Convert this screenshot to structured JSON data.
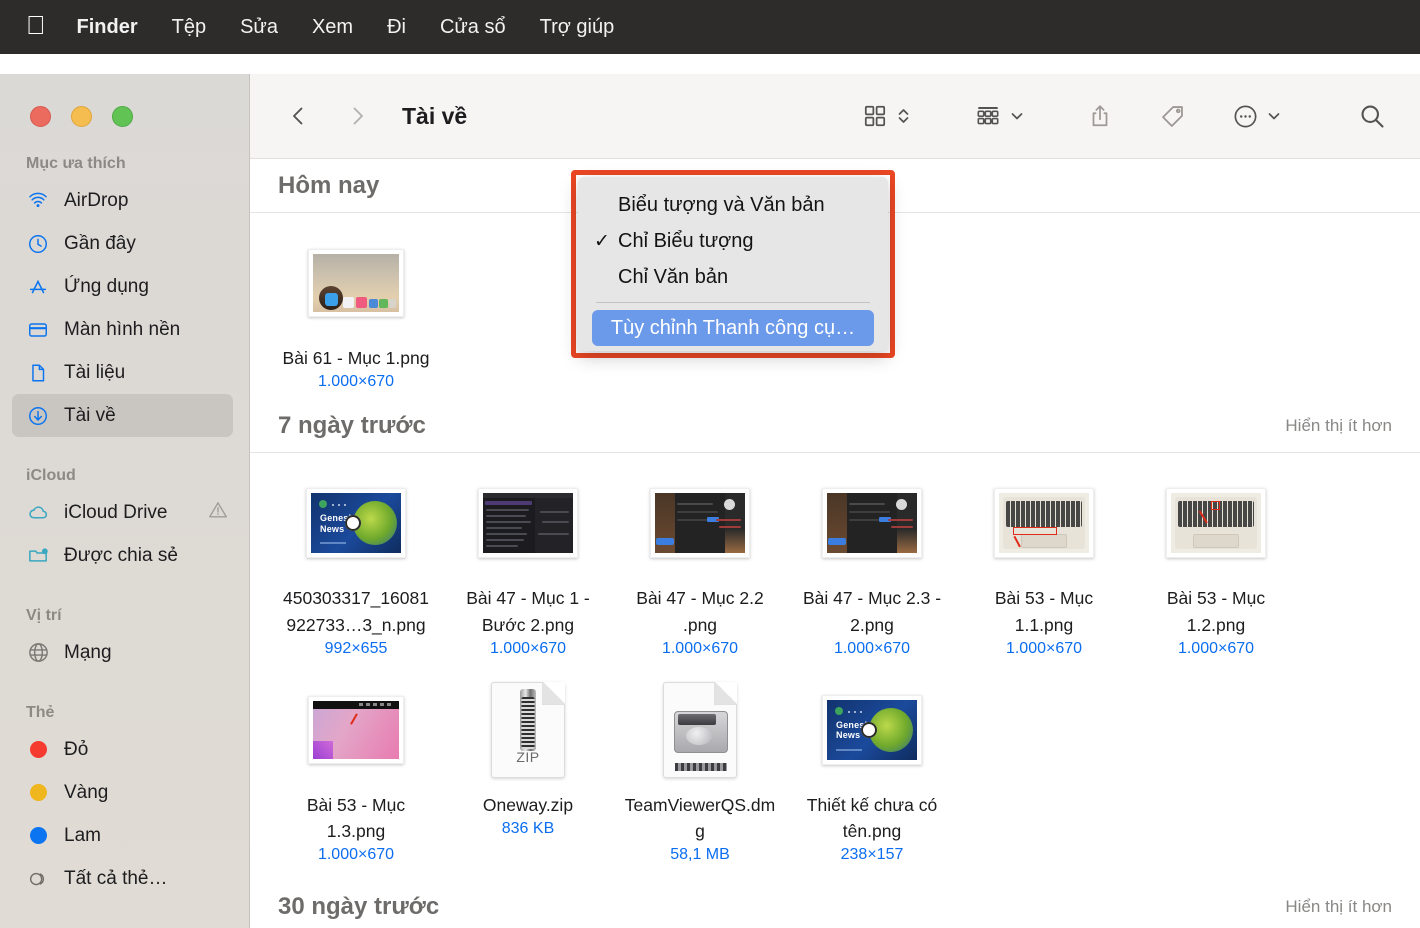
{
  "menubar": {
    "apple_icon": "apple-logo",
    "items": [
      {
        "label": "Finder",
        "bold": true
      },
      {
        "label": "Tệp",
        "bold": false
      },
      {
        "label": "Sửa",
        "bold": false
      },
      {
        "label": "Xem",
        "bold": false
      },
      {
        "label": "Đi",
        "bold": false
      },
      {
        "label": "Cửa sổ",
        "bold": false
      },
      {
        "label": "Trợ giúp",
        "bold": false
      }
    ]
  },
  "window": {
    "title": "Tài về",
    "traffic_lights": {
      "close": "#eb6b5f",
      "minimize": "#f5bd4f",
      "zoom": "#60c354"
    }
  },
  "toolbar": {
    "back_icon": "chevron-left-icon",
    "forward_icon": "chevron-right-icon",
    "view_icon": "icon-view-grid-icon",
    "view_sort_icon": "chevron-up-down-icon",
    "group_icon": "group-by-icon",
    "group_chevron_icon": "chevron-down-icon",
    "share_icon": "share-icon",
    "tag_icon": "tag-icon",
    "more_icon": "ellipsis-circle-icon",
    "more_chevron_icon": "chevron-down-icon",
    "search_icon": "search-icon"
  },
  "sidebar": {
    "groups": [
      {
        "title": "Mục ưa thích",
        "items": [
          {
            "label": "AirDrop",
            "icon": "airdrop-icon",
            "selected": false
          },
          {
            "label": "Gần đây",
            "icon": "clock-icon",
            "selected": false
          },
          {
            "label": "Ứng dụng",
            "icon": "appstore-icon",
            "selected": false
          },
          {
            "label": "Màn hình nền",
            "icon": "desktop-icon",
            "selected": false
          },
          {
            "label": "Tài liệu",
            "icon": "document-icon",
            "selected": false
          },
          {
            "label": "Tài về",
            "icon": "download-icon",
            "selected": true
          }
        ]
      },
      {
        "title": "iCloud",
        "items": [
          {
            "label": "iCloud Drive",
            "icon": "cloud-icon",
            "selected": false,
            "badge": "warning-icon"
          },
          {
            "label": "Được chia sẻ",
            "icon": "shared-folder-icon",
            "selected": false
          }
        ]
      },
      {
        "title": "Vị trí",
        "items": [
          {
            "label": "Mạng",
            "icon": "globe-icon",
            "selected": false
          }
        ]
      },
      {
        "title": "Thẻ",
        "items": [
          {
            "label": "Đỏ",
            "icon": "tag-dot-icon",
            "color": "#f53b30",
            "selected": false
          },
          {
            "label": "Vàng",
            "icon": "tag-dot-icon",
            "color": "#f0b61e",
            "selected": false
          },
          {
            "label": "Lam",
            "icon": "tag-dot-icon",
            "color": "#0b74f0",
            "selected": false
          },
          {
            "label": "Tất cả thẻ…",
            "icon": "all-tags-icon",
            "selected": false
          }
        ]
      }
    ]
  },
  "context_menu": {
    "highlight_color": "#eb4724",
    "items": [
      {
        "label": "Biểu tượng và Văn bản",
        "checked": false
      },
      {
        "label": "Chỉ Biểu tượng",
        "checked": true
      },
      {
        "label": "Chỉ Văn bản",
        "checked": false
      }
    ],
    "check_glyph": "✓",
    "primary_action": "Tùy chỉnh Thanh công cụ…"
  },
  "browser": {
    "sections": [
      {
        "title": "Hôm nay",
        "action": "",
        "files": [
          {
            "name": "Bài 61 - Mục 1.png",
            "meta": "1.000×670",
            "thumb": "desktop"
          }
        ]
      },
      {
        "title": "7 ngày trước",
        "action": "Hiển thị ít hơn",
        "files": [
          {
            "name": "450303317_16081922733…3_n.png",
            "meta": "992×655",
            "thumb": "genesis"
          },
          {
            "name": "Bài 47 - Mục 1 - Bước 2.png",
            "meta": "1.000×670",
            "thumb": "darkide"
          },
          {
            "name": "Bài 47 - Mục 2.2 .png",
            "meta": "1.000×670",
            "thumb": "discord"
          },
          {
            "name": "Bài 47 - Mục 2.3 - 2.png",
            "meta": "1.000×670",
            "thumb": "discord"
          },
          {
            "name": "Bài 53 - Mục 1.1.png",
            "meta": "1.000×670",
            "thumb": "keyboard-low"
          },
          {
            "name": "Bài 53 - Mục 1.2.png",
            "meta": "1.000×670",
            "thumb": "keyboard-high"
          },
          {
            "name": "Bài 53 - Mục 1.3.png",
            "meta": "1.000×670",
            "thumb": "pinkdesk"
          },
          {
            "name": "Oneway.zip",
            "meta": "836 KB",
            "thumb": "zip"
          },
          {
            "name": "TeamViewerQS.dmg",
            "meta": "58,1 MB",
            "thumb": "dmg"
          },
          {
            "name": "Thiết kế chưa có tên.png",
            "meta": "238×157",
            "thumb": "genesis"
          }
        ]
      },
      {
        "title": "30 ngày trước",
        "action": "Hiển thị ít hơn",
        "files": []
      }
    ]
  }
}
